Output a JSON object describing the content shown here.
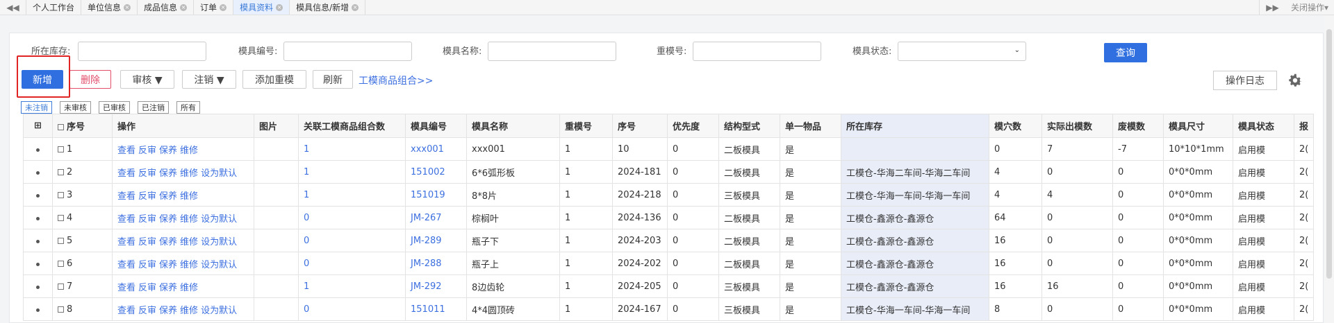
{
  "tabbar": {
    "tabs": [
      {
        "label": "个人工作台",
        "closable": false,
        "active": false
      },
      {
        "label": "单位信息",
        "closable": true,
        "active": false
      },
      {
        "label": "成品信息",
        "closable": true,
        "active": false
      },
      {
        "label": "订单",
        "closable": true,
        "active": false
      },
      {
        "label": "模具资料",
        "closable": true,
        "active": true
      },
      {
        "label": "模具信息/新增",
        "closable": true,
        "active": false
      }
    ],
    "close_ops": "关闭操作"
  },
  "search": {
    "warehouse_label": "所在库存:",
    "mold_no_label": "模具编号:",
    "mold_name_label": "模具名称:",
    "repeat_no_label": "重模号:",
    "status_label": "模具状态:",
    "query_label": "查询"
  },
  "toolbar": {
    "add_label": "新增",
    "delete_label": "删除",
    "audit_label": "审核 ▼",
    "cancel_label": "注销 ▼",
    "add_repeat_label": "添加重模",
    "refresh_label": "刷新",
    "combo_link": "工模商品组合>>",
    "log_label": "操作日志"
  },
  "filters": [
    "未注销",
    "未审核",
    "已审核",
    "已注销",
    "所有"
  ],
  "table": {
    "headers": [
      "序号",
      "操作",
      "图片",
      "关联工模商品组合数",
      "模具编号",
      "模具名称",
      "重模号",
      "序号",
      "优先度",
      "结构型式",
      "单一物品",
      "所在库存",
      "模穴数",
      "实际出模数",
      "废模数",
      "模具尺寸",
      "模具状态",
      "报"
    ],
    "expand_symbol": "⊞",
    "rows": [
      {
        "seq": "1",
        "ops": [
          "查看",
          "反审",
          "保养",
          "维修"
        ],
        "combo": "1",
        "mold_no": "xxx001",
        "mold_name": "xxx001",
        "repeat": "1",
        "serial": "10",
        "priority": "0",
        "structure": "二板模具",
        "single": "是",
        "warehouse": "",
        "cavities": "0",
        "actual": "7",
        "scrap": "-7",
        "size": "10*10*1mm",
        "status": "启用模",
        "extra": "2("
      },
      {
        "seq": "2",
        "ops": [
          "查看",
          "反审",
          "保养",
          "维修",
          "设为默认"
        ],
        "combo": "1",
        "mold_no": "151002",
        "mold_name": "6*6弧形板",
        "repeat": "1",
        "serial": "2024-181",
        "priority": "0",
        "structure": "二板模具",
        "single": "是",
        "warehouse": "工模仓-华海二车间-华海二车间",
        "cavities": "4",
        "actual": "0",
        "scrap": "0",
        "size": "0*0*0mm",
        "status": "启用模",
        "extra": "2("
      },
      {
        "seq": "3",
        "ops": [
          "查看",
          "反审",
          "保养",
          "维修"
        ],
        "combo": "1",
        "mold_no": "151019",
        "mold_name": "8*8片",
        "repeat": "1",
        "serial": "2024-218",
        "priority": "0",
        "structure": "三板模具",
        "single": "是",
        "warehouse": "工模仓-华海一车间-华海一车间",
        "cavities": "4",
        "actual": "4",
        "scrap": "0",
        "size": "0*0*0mm",
        "status": "启用模",
        "extra": "2("
      },
      {
        "seq": "4",
        "ops": [
          "查看",
          "反审",
          "保养",
          "维修",
          "设为默认"
        ],
        "combo": "0",
        "mold_no": "JM-267",
        "mold_name": "棕榈叶",
        "repeat": "1",
        "serial": "2024-136",
        "priority": "0",
        "structure": "二板模具",
        "single": "是",
        "warehouse": "工模仓-鑫源仓-鑫源仓",
        "cavities": "64",
        "actual": "0",
        "scrap": "0",
        "size": "0*0*0mm",
        "status": "启用模",
        "extra": "2("
      },
      {
        "seq": "5",
        "ops": [
          "查看",
          "反审",
          "保养",
          "维修",
          "设为默认"
        ],
        "combo": "0",
        "mold_no": "JM-289",
        "mold_name": "瓶子下",
        "repeat": "1",
        "serial": "2024-203",
        "priority": "0",
        "structure": "二板模具",
        "single": "是",
        "warehouse": "工模仓-鑫源仓-鑫源仓",
        "cavities": "16",
        "actual": "0",
        "scrap": "0",
        "size": "0*0*0mm",
        "status": "启用模",
        "extra": "2("
      },
      {
        "seq": "6",
        "ops": [
          "查看",
          "反审",
          "保养",
          "维修",
          "设为默认"
        ],
        "combo": "0",
        "mold_no": "JM-288",
        "mold_name": "瓶子上",
        "repeat": "1",
        "serial": "2024-202",
        "priority": "0",
        "structure": "二板模具",
        "single": "是",
        "warehouse": "工模仓-鑫源仓-鑫源仓",
        "cavities": "16",
        "actual": "0",
        "scrap": "0",
        "size": "0*0*0mm",
        "status": "启用模",
        "extra": "2("
      },
      {
        "seq": "7",
        "ops": [
          "查看",
          "反审",
          "保养",
          "维修"
        ],
        "combo": "1",
        "mold_no": "JM-292",
        "mold_name": "8边齿轮",
        "repeat": "1",
        "serial": "2024-205",
        "priority": "0",
        "structure": "三板模具",
        "single": "是",
        "warehouse": "工模仓-鑫源仓-鑫源仓",
        "cavities": "16",
        "actual": "16",
        "scrap": "0",
        "size": "0*0*0mm",
        "status": "启用模",
        "extra": "2("
      },
      {
        "seq": "8",
        "ops": [
          "查看",
          "反审",
          "保养",
          "维修",
          "设为默认"
        ],
        "combo": "0",
        "mold_no": "151011",
        "mold_name": "4*4圆顶砖",
        "repeat": "1",
        "serial": "2024-167",
        "priority": "0",
        "structure": "三板模具",
        "single": "是",
        "warehouse": "工模仓-华海一车间-华海一车间",
        "cavities": "8",
        "actual": "0",
        "scrap": "0",
        "size": "0*0*0mm",
        "status": "启用模",
        "extra": "2("
      }
    ]
  },
  "colors": {
    "accent": "#2f6fe0",
    "link": "#3c6fe0",
    "danger": "#e24d6a",
    "highlight": "#e02424"
  }
}
